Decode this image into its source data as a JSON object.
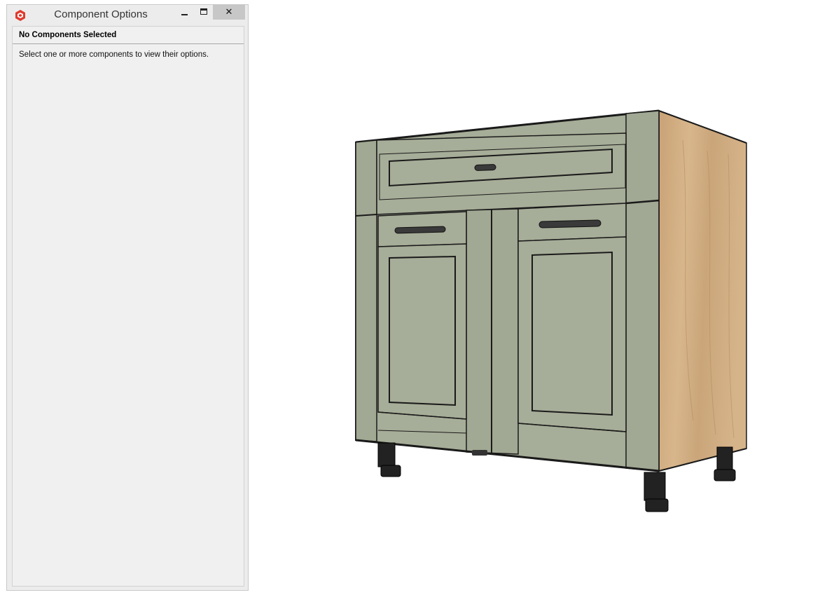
{
  "window": {
    "title": "Component Options",
    "minimize_icon": "minimize-icon",
    "maximize_icon": "maximize-icon",
    "close_glyph": "✕",
    "app_icon": "sketchup-icon"
  },
  "panel": {
    "header": "No Components Selected",
    "message": "Select one or more components to view their options."
  },
  "colors": {
    "panel_bg": "#ececec",
    "content_bg": "#f0f0f0",
    "cabinet_face": "#a6ad98",
    "cabinet_side_wood": "#d1ae84",
    "outline": "#1a1a1a",
    "legs": "#222222",
    "sketchup_red": "#e03a2e"
  },
  "viewport": {
    "model": "kitchen-base-cabinet",
    "icons": [
      "drawer-handle-icon",
      "door-handle-icon",
      "cabinet-leg-icon"
    ]
  }
}
